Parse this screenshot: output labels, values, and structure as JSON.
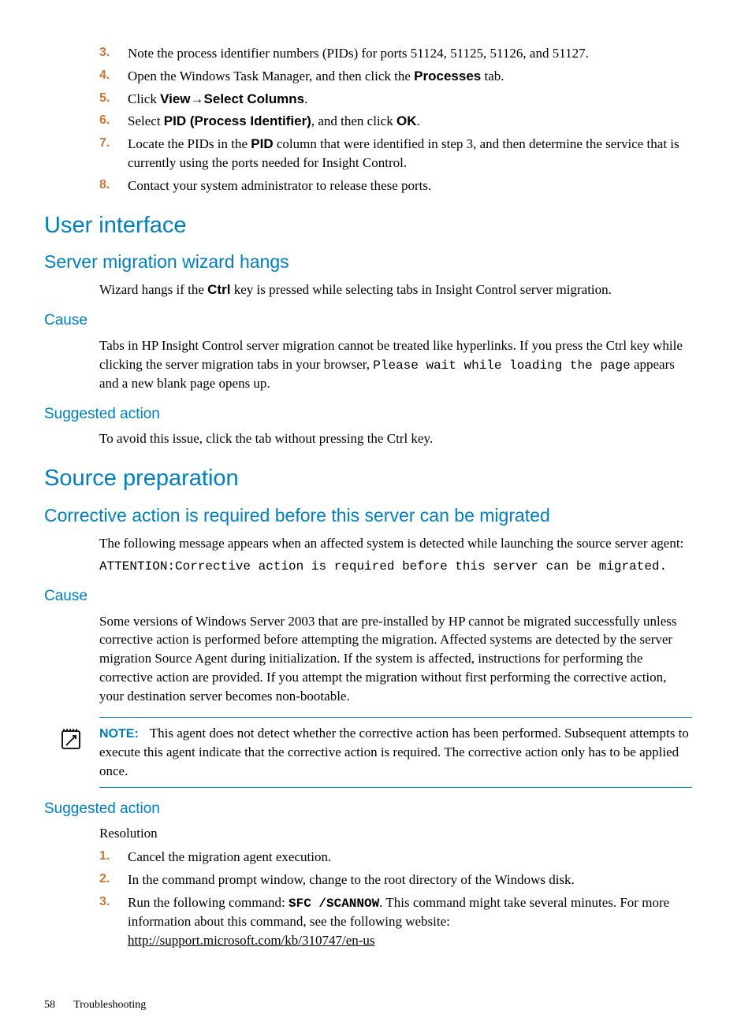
{
  "steps_top": [
    {
      "n": "3.",
      "text": "Note the process identifier numbers (PIDs) for ports 51124, 51125, 51126, and 51127."
    },
    {
      "n": "4.",
      "pre": "Open the Windows Task Manager, and then click the ",
      "bold": "Processes",
      "post": " tab."
    },
    {
      "n": "5.",
      "pre": "Click ",
      "bold": "View",
      "arrow": "→",
      "bold2": "Select Columns",
      "post": "."
    },
    {
      "n": "6.",
      "pre": "Select ",
      "bold": "PID (Process Identifier)",
      "mid": ", and then click ",
      "bold2": "OK",
      "post": "."
    },
    {
      "n": "7.",
      "pre": "Locate the PIDs in the ",
      "bold": "PID",
      "post": " column that were identified in step 3, and then determine the service that is currently using the ports needed for Insight Control."
    },
    {
      "n": "8.",
      "text": "Contact your system administrator to release these ports."
    }
  ],
  "h_user_interface": "User interface",
  "h_wizard": "Server migration wizard hangs",
  "wizard_intro_pre": "Wizard hangs if the ",
  "wizard_intro_bold": "Ctrl",
  "wizard_intro_post": " key is pressed while selecting tabs in Insight Control server migration.",
  "h_cause": "Cause",
  "cause1_pre": "Tabs in HP Insight Control server migration cannot be treated like hyperlinks. If you press the Ctrl key while clicking the server migration tabs in your browser, ",
  "cause1_mono": "Please wait while loading the page",
  "cause1_post": " appears and a new blank page opens up.",
  "h_suggested": "Suggested action",
  "suggested1": "To avoid this issue, click the tab without pressing the Ctrl key.",
  "h_source_prep": "Source preparation",
  "h_corrective": "Corrective action is required before this server can be migrated",
  "corrective_intro": "The following message appears when an affected system is detected while launching the source server agent:",
  "corrective_msg": "ATTENTION:Corrective action is required before this server can be migrated.",
  "cause2": "Some versions of Windows Server 2003 that are pre-installed by HP cannot be migrated successfully unless corrective action is performed before attempting the migration. Affected systems are detected by the server migration Source Agent during initialization. If the system is affected, instructions for performing the corrective action are provided. If you attempt the migration without first performing the corrective action, your destination server becomes non-bootable.",
  "note_label": "NOTE:",
  "note_text": "This agent does not detect whether the corrective action has been performed. Subsequent attempts to execute this agent indicate that the corrective action is required. The corrective action only has to be applied once.",
  "resolution_label": "Resolution",
  "steps_bottom": [
    {
      "n": "1.",
      "text": "Cancel the migration agent execution."
    },
    {
      "n": "2.",
      "text": "In the command prompt window, change to the root directory of the Windows disk."
    },
    {
      "n": "3.",
      "pre": "Run the following command: ",
      "mono_bold": "SFC /SCANNOW",
      "post": ". This command might take several minutes. For more information about this command, see the following website:"
    }
  ],
  "url": "http://support.microsoft.com/kb/310747/en-us",
  "page_number": "58",
  "footer_title": "Troubleshooting"
}
